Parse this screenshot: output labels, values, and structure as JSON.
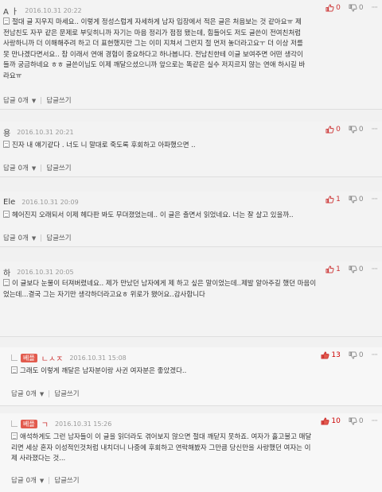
{
  "ui": {
    "reply_label": "답글",
    "write_reply_label": "답글쓰기",
    "more_dots": "····",
    "best_badge": "베플"
  },
  "comments": [
    {
      "nick": "A ㅏ",
      "date": "2016.10.31 20:22",
      "up": "0",
      "down": "0",
      "lines": [
        "절대 글 지우지 마세요.. 이렇게 정성스럽게 자세하게 남자 입장에서 적은 글은 처음보는 것 같아요ㅠ 제",
        "전남친도 자꾸 같은 문제로 부딪히니까 자기는 마음 정리가 점점 됐는데, 힘들어도 저도 글쓴이 전여친처럼",
        "사랑하니까 더 이해해주려 하고 더 표현했지만 그는 이미 지쳐서 그런지 절 먼저 놓더라고요ㅜ 더 이상 저를",
        "못 만나겠다면서요.. 참 이래서 연애 경험이 중요하다고 하나봅니다. 전남친한테 이글 보여주면 어떤 생각이",
        "들까 궁금하네요 ㅎㅎ 글쓴이님도 이제 깨달으셨으니까 앞으로는 똑같은 실수 저지르지 않는 연애 하시길 바",
        "라요ㅠ"
      ],
      "reply_count": "0개"
    },
    {
      "nick": "용",
      "date": "2016.10.31 20:21",
      "up": "0",
      "down": "0",
      "lines": [
        "진자 내 얘기같다 . 너도 니 말대로 죽도록 후회하고 아파했으면 .."
      ],
      "reply_count": "0개"
    },
    {
      "nick": "Ele",
      "date": "2016.10.31 20:09",
      "up": "1",
      "down": "0",
      "lines": [
        "헤어진지 오래되서 이제 헤다판 봐도 무뎌졌었는데.. 이 글은 출면서 읽었네요. 너는 잘 살고 있을까.."
      ],
      "reply_count": "0개"
    },
    {
      "nick": "하",
      "date": "2016.10.31 20:05",
      "up": "1",
      "down": "0",
      "lines": [
        "이 글보다 눈물이 터져버렸네요.. 제가 만났던 남자에게 제 하고 싶은 말이었는데..제발 알아주길 했던 마음이",
        "었는데...결국 그는 자기만 생각하더라고요ㅎ 위로가 됐어요..감사합니다"
      ],
      "reply_count": ""
    },
    {
      "nick": "ㄴㅅㅈ",
      "date": "2016.10.31 15:08",
      "up": "13",
      "down": "0",
      "lines": [
        "그래도 이렇게 깨달은 남자분이랑 사귄 여자분은 좋았겠다.."
      ],
      "reply_count": "0개"
    },
    {
      "nick": "ㄱ",
      "date": "2016.10.31 15:26",
      "up": "10",
      "down": "0",
      "lines": [
        "애석하게도 그런 남자들이 이 글을 읽더라도 겪어보지 않으면 절대 깨닫지 못하죠. 여자가 홀고불고 매달",
        "리면 세상 혼자 이성적인것처럼 내치더니 나중에 후회하고 연락해봤자 그만큼 당신만을 사랑했던 여자는 이",
        "제 사라졌다는 것..."
      ],
      "reply_count": "0개"
    }
  ]
}
